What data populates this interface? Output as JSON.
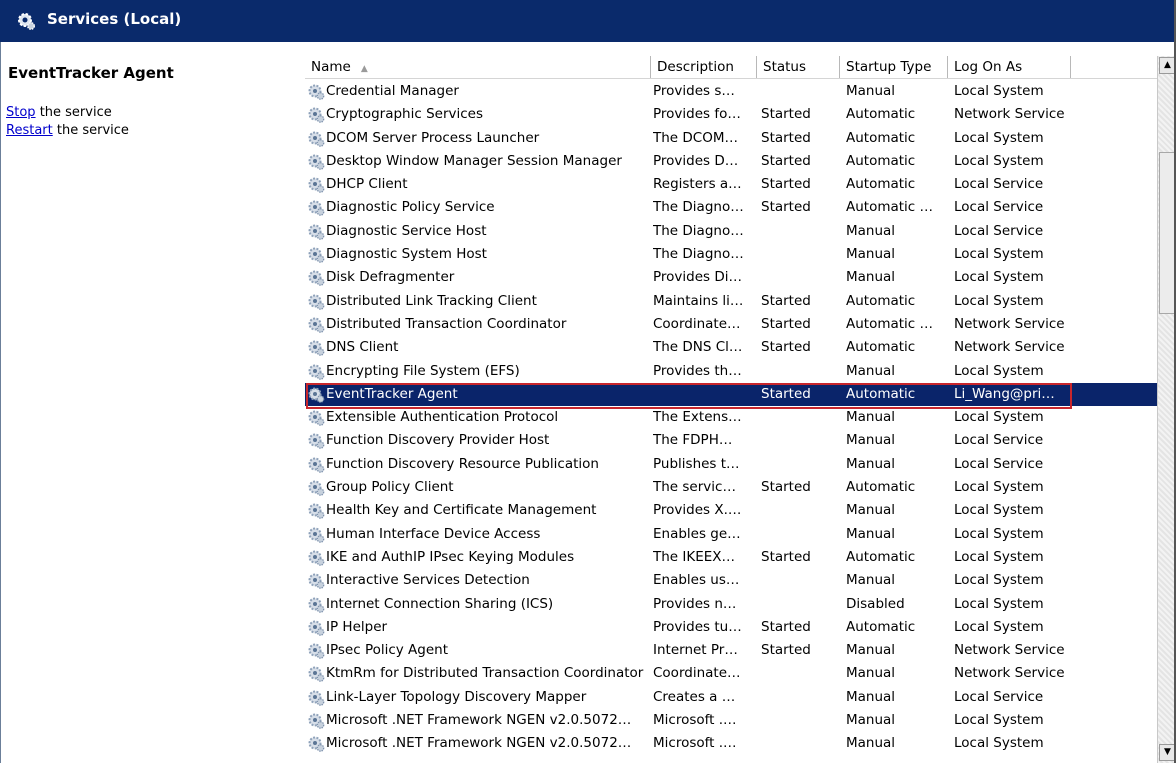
{
  "title": "Services (Local)",
  "left_panel": {
    "service_name": "EventTracker Agent",
    "actions": [
      {
        "link": "Stop",
        "rest": " the service"
      },
      {
        "link": "Restart",
        "rest": " the service"
      }
    ]
  },
  "columns": [
    "Name",
    "Description",
    "Status",
    "Startup Type",
    "Log On As"
  ],
  "selected_index": 13,
  "services": [
    {
      "name": "Credential Manager",
      "description": "Provides s…",
      "status": "",
      "startup": "Manual",
      "logon": "Local System"
    },
    {
      "name": "Cryptographic Services",
      "description": "Provides fo…",
      "status": "Started",
      "startup": "Automatic",
      "logon": "Network Service"
    },
    {
      "name": "DCOM Server Process Launcher",
      "description": "The DCOM…",
      "status": "Started",
      "startup": "Automatic",
      "logon": "Local System"
    },
    {
      "name": "Desktop Window Manager Session Manager",
      "description": "Provides D…",
      "status": "Started",
      "startup": "Automatic",
      "logon": "Local System"
    },
    {
      "name": "DHCP Client",
      "description": "Registers a…",
      "status": "Started",
      "startup": "Automatic",
      "logon": "Local Service"
    },
    {
      "name": "Diagnostic Policy Service",
      "description": "The Diagno…",
      "status": "Started",
      "startup": "Automatic …",
      "logon": "Local Service"
    },
    {
      "name": "Diagnostic Service Host",
      "description": "The Diagno…",
      "status": "",
      "startup": "Manual",
      "logon": "Local Service"
    },
    {
      "name": "Diagnostic System Host",
      "description": "The Diagno…",
      "status": "",
      "startup": "Manual",
      "logon": "Local System"
    },
    {
      "name": "Disk Defragmenter",
      "description": "Provides Di…",
      "status": "",
      "startup": "Manual",
      "logon": "Local System"
    },
    {
      "name": "Distributed Link Tracking Client",
      "description": "Maintains li…",
      "status": "Started",
      "startup": "Automatic",
      "logon": "Local System"
    },
    {
      "name": "Distributed Transaction Coordinator",
      "description": "Coordinate…",
      "status": "Started",
      "startup": "Automatic …",
      "logon": "Network Service"
    },
    {
      "name": "DNS Client",
      "description": "The DNS Cl…",
      "status": "Started",
      "startup": "Automatic",
      "logon": "Network Service"
    },
    {
      "name": "Encrypting File System (EFS)",
      "description": "Provides th…",
      "status": "",
      "startup": "Manual",
      "logon": "Local System"
    },
    {
      "name": "EventTracker Agent",
      "description": "",
      "status": "Started",
      "startup": "Automatic",
      "logon": "Li_Wang@pri…"
    },
    {
      "name": "Extensible Authentication Protocol",
      "description": "The Extens…",
      "status": "",
      "startup": "Manual",
      "logon": "Local System"
    },
    {
      "name": "Function Discovery Provider Host",
      "description": "The FDPH…",
      "status": "",
      "startup": "Manual",
      "logon": "Local Service"
    },
    {
      "name": "Function Discovery Resource Publication",
      "description": "Publishes t…",
      "status": "",
      "startup": "Manual",
      "logon": "Local Service"
    },
    {
      "name": "Group Policy Client",
      "description": "The servic…",
      "status": "Started",
      "startup": "Automatic",
      "logon": "Local System"
    },
    {
      "name": "Health Key and Certificate Management",
      "description": "Provides X.…",
      "status": "",
      "startup": "Manual",
      "logon": "Local System"
    },
    {
      "name": "Human Interface Device Access",
      "description": "Enables ge…",
      "status": "",
      "startup": "Manual",
      "logon": "Local System"
    },
    {
      "name": "IKE and AuthIP IPsec Keying Modules",
      "description": "The IKEEX…",
      "status": "Started",
      "startup": "Automatic",
      "logon": "Local System"
    },
    {
      "name": "Interactive Services Detection",
      "description": "Enables us…",
      "status": "",
      "startup": "Manual",
      "logon": "Local System"
    },
    {
      "name": "Internet Connection Sharing (ICS)",
      "description": "Provides n…",
      "status": "",
      "startup": "Disabled",
      "logon": "Local System"
    },
    {
      "name": "IP Helper",
      "description": "Provides tu…",
      "status": "Started",
      "startup": "Automatic",
      "logon": "Local System"
    },
    {
      "name": "IPsec Policy Agent",
      "description": "Internet Pr…",
      "status": "Started",
      "startup": "Manual",
      "logon": "Network Service"
    },
    {
      "name": "KtmRm for Distributed Transaction Coordinator",
      "description": "Coordinate…",
      "status": "",
      "startup": "Manual",
      "logon": "Network Service"
    },
    {
      "name": "Link-Layer Topology Discovery Mapper",
      "description": "Creates a …",
      "status": "",
      "startup": "Manual",
      "logon": "Local Service"
    },
    {
      "name": "Microsoft .NET Framework NGEN v2.0.5072…",
      "description": "Microsoft .…",
      "status": "",
      "startup": "Manual",
      "logon": "Local System"
    },
    {
      "name": "Microsoft .NET Framework NGEN v2.0.5072…",
      "description": "Microsoft .…",
      "status": "",
      "startup": "Manual",
      "logon": "Local System"
    }
  ]
}
